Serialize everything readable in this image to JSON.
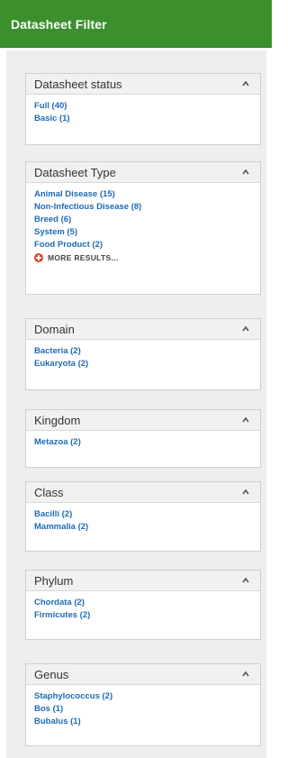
{
  "header": {
    "title": "Datasheet Filter"
  },
  "filters": {
    "status": {
      "title": "Datasheet status",
      "items": [
        "Full (40)",
        "Basic (1)"
      ]
    },
    "type": {
      "title": "Datasheet Type",
      "items": [
        "Animal Disease (15)",
        "Non-Infectious Disease (8)",
        "Breed (6)",
        "System (5)",
        "Food Product (2)"
      ],
      "more_label": "MORE RESULTS..."
    },
    "domain": {
      "title": "Domain",
      "items": [
        "Bacteria (2)",
        "Eukaryota (2)"
      ]
    },
    "kingdom": {
      "title": "Kingdom",
      "items": [
        "Metazoa (2)"
      ]
    },
    "class": {
      "title": "Class",
      "items": [
        "Bacilli (2)",
        "Mammalia (2)"
      ]
    },
    "phylum": {
      "title": "Phylum",
      "items": [
        "Chordata (2)",
        "Firmicutes (2)"
      ]
    },
    "genus": {
      "title": "Genus",
      "items": [
        "Staphylococcus (2)",
        "Bos (1)",
        "Bubalus (1)"
      ]
    }
  },
  "colors": {
    "header": "#3b8f2c",
    "link": "#1e6ab4",
    "more_icon": "#d9462f"
  },
  "icons": {
    "collapse": "chevron-up-icon",
    "more": "plus-circle-icon"
  }
}
